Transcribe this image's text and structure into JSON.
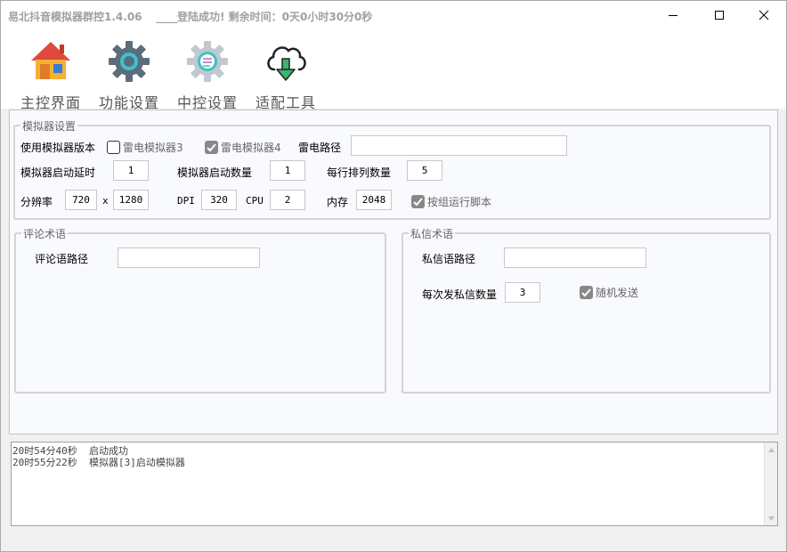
{
  "window": {
    "title": "易北抖音模拟器群控1.4.06",
    "status": "____登陆成功! 剩余时间：0天0小时30分0秒"
  },
  "toolbar": {
    "items": [
      {
        "label": "主控界面",
        "icon": "house-icon"
      },
      {
        "label": "功能设置",
        "icon": "gear-icon"
      },
      {
        "label": "中控设置",
        "icon": "gear-settings-icon"
      },
      {
        "label": "适配工具",
        "icon": "cloud-download-icon"
      }
    ]
  },
  "emulator": {
    "group_title": "模拟器设置",
    "version_label": "使用模拟器版本",
    "ld3_label": "雷电模拟器3",
    "ld3_checked": false,
    "ld4_label": "雷电模拟器4",
    "ld4_checked": true,
    "path_label": "雷电路径",
    "path_value": "",
    "delay_label": "模拟器启动延时",
    "delay_value": "1",
    "count_label": "模拟器启动数量",
    "count_value": "1",
    "row_label": "每行排列数量",
    "row_value": "5",
    "resolution_label": "分辨率",
    "width_value": "720",
    "x_label": "x",
    "height_value": "1280",
    "dpi_label": "DPI",
    "dpi_value": "320",
    "cpu_label": "CPU",
    "cpu_value": "2",
    "memory_label": "内存",
    "memory_value": "2048",
    "group_run_label": "按组运行脚本",
    "group_run_checked": true
  },
  "comment": {
    "group_title": "评论术语",
    "path_label": "评论语路径",
    "path_value": ""
  },
  "private_msg": {
    "group_title": "私信术语",
    "path_label": "私信语路径",
    "path_value": "",
    "count_label": "每次发私信数量",
    "count_value": "3",
    "random_label": "随机发送",
    "random_checked": true
  },
  "log": {
    "lines": [
      "20时54分40秒  启动成功",
      "20时55分22秒  模拟器[3]启动模拟器"
    ]
  },
  "colors": {
    "title_text": "#a0a0a0",
    "panel_border": "#b9c4d0",
    "checked_box": "#888888",
    "house_roof": "#e04a3a",
    "house_wall": "#f2b233",
    "house_window": "#3a7bd5",
    "gear": "#5a6d7c",
    "gear_center": "#3fc1c9",
    "gear_light": "#c0c8d0",
    "download_arrow": "#3cb371"
  }
}
